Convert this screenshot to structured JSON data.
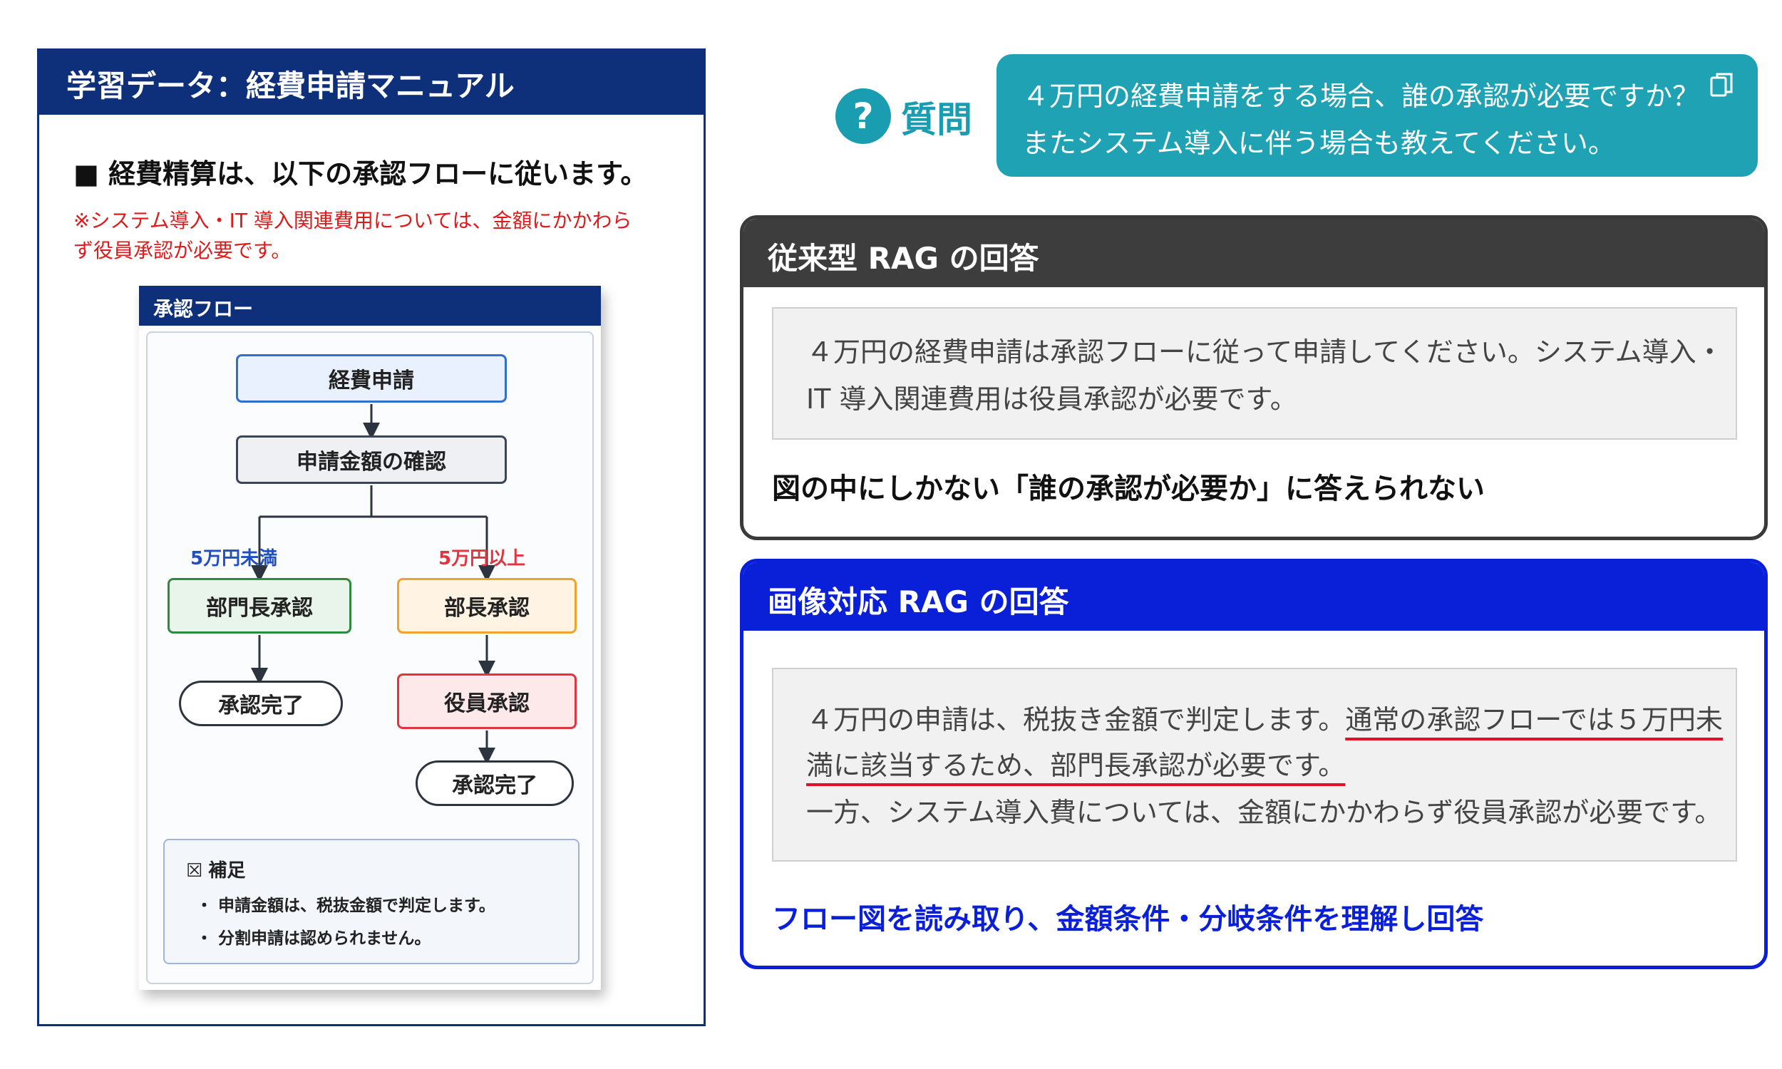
{
  "manual": {
    "title": "学習データ：経費申請マニュアル",
    "heading": "■ 経費精算は、以下の承認フローに従います。",
    "note": "※システム導入・IT 導入関連費用については、金額にかかわらず役員承認が必要です。"
  },
  "flow": {
    "card_title": "承認フロー",
    "nodes": {
      "expense_request": "経費申請",
      "amount_check": "申請金額の確認",
      "dept_head": "部門長承認",
      "division_head": "部長承認",
      "executive": "役員承認",
      "done_left": "承認完了",
      "done_right": "承認完了"
    },
    "branches": {
      "under": "5万円未満",
      "over": "5万円以上"
    },
    "supplement": {
      "glyph": "☒",
      "title": "補足",
      "items": [
        "・ 申請金額は、税抜金額で判定します。",
        "・ 分割申請は認められません。"
      ]
    }
  },
  "question": {
    "icon": "?",
    "label": "質問",
    "line1": "４万円の経費申請をする場合、誰の承認が必要ですか？",
    "line2": "またシステム導入に伴う場合も教えてください。"
  },
  "traditional": {
    "title": "従来型 RAG の回答",
    "line1": "４万円の経費申請は承認フローに従って申請してください。システム導入・",
    "line2": "IT 導入関連費用は役員承認が必要です。",
    "conclusion": "図の中にしかない「誰の承認が必要か」に答えられない"
  },
  "image_rag": {
    "title": "画像対応 RAG の回答",
    "line1_plain": "４万円の申請は、税抜き金額で判定します。",
    "line1_underlined": "通常の承認フローでは５万円未",
    "line2_underlined": "満に該当するため、部門長承認が必要です。",
    "line3": "一方、システム導入費については、金額にかかわらず役員承認が必要です。",
    "conclusion": "フロー図を読み取り、金額条件・分岐条件を理解し回答"
  },
  "colors": {
    "navy": "#0e2f7a",
    "teal": "#1fa3b4",
    "blue": "#0a1fd8",
    "red": "#e0102a"
  }
}
